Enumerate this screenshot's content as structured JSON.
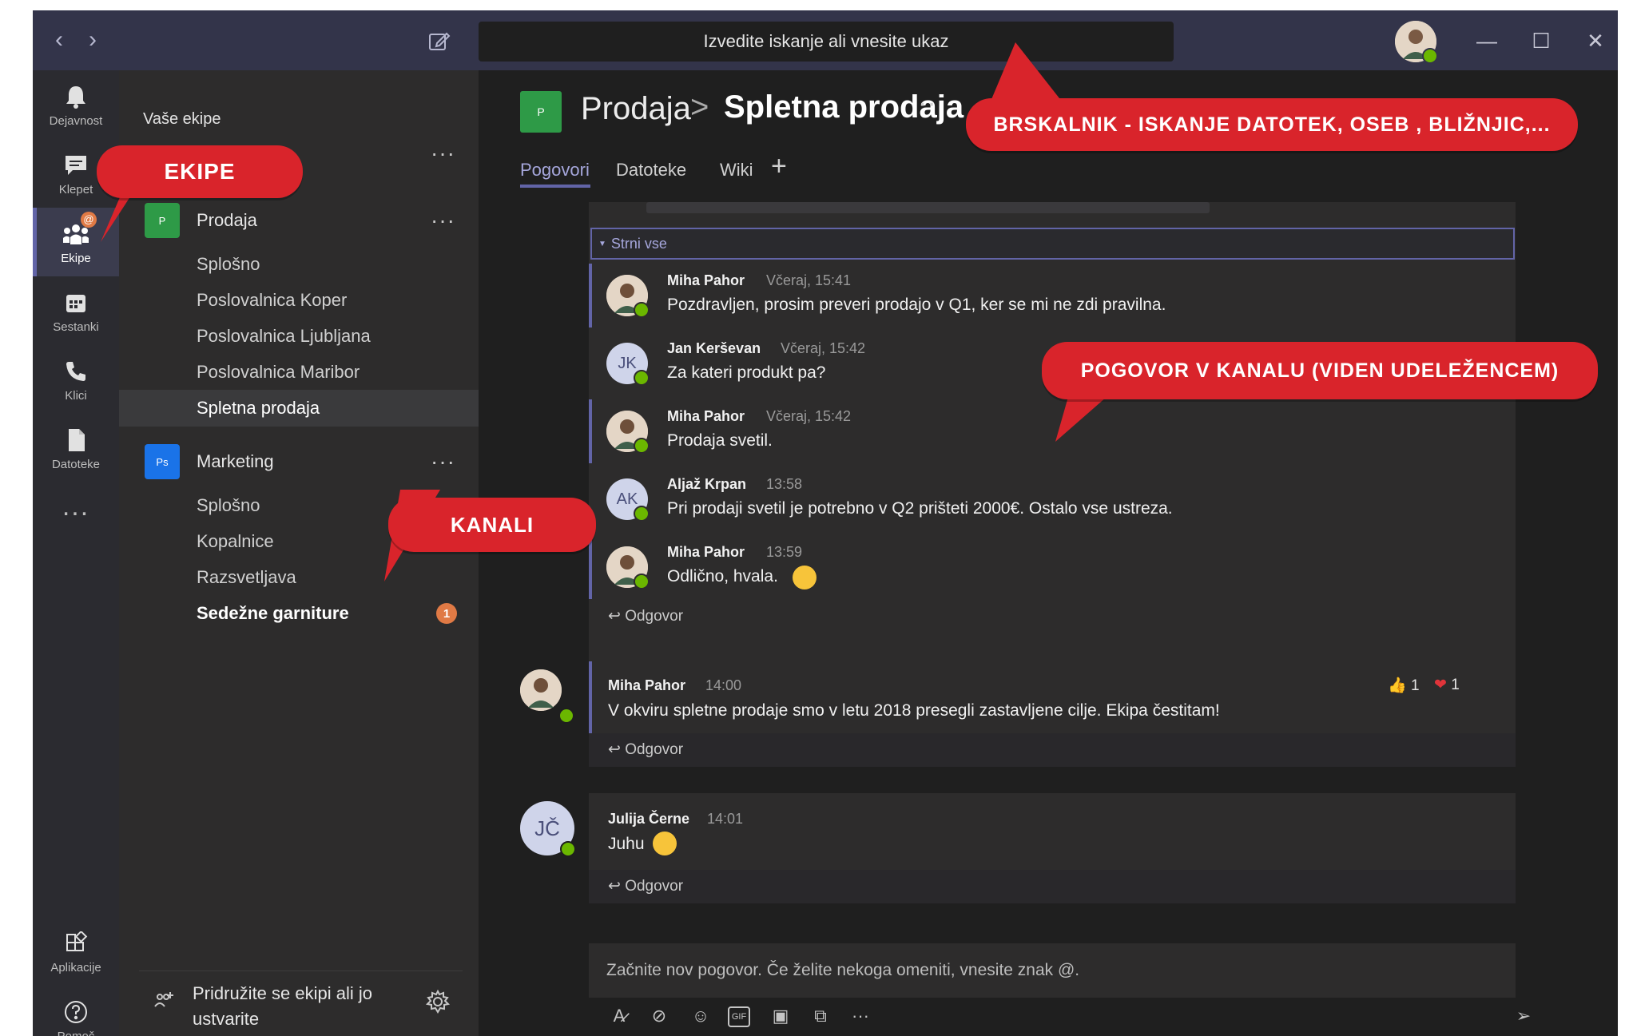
{
  "search": {
    "placeholder": "Izvedite iskanje ali vnesite ukaz"
  },
  "rail": {
    "items": [
      {
        "label": "Dejavnost",
        "icon": "bell-icon"
      },
      {
        "label": "Klepet",
        "icon": "chat-icon"
      },
      {
        "label": "Ekipe",
        "icon": "teams-icon"
      },
      {
        "label": "Sestanki",
        "icon": "calendar-icon"
      },
      {
        "label": "Klici",
        "icon": "phone-icon"
      },
      {
        "label": "Datoteke",
        "icon": "file-icon"
      }
    ],
    "more": "...",
    "apps": "Aplikacije",
    "help": "Pomoč",
    "teams_badge": "@"
  },
  "panel": {
    "title": "Vaše ekipe",
    "teams": [
      {
        "tile": "P",
        "tile_color": "#2e9a47",
        "name": "Prodaja",
        "channels": [
          "Splošno",
          "Poslovalnica Koper",
          "Poslovalnica Ljubljana",
          "Poslovalnica Maribor",
          "Spletna prodaja"
        ]
      },
      {
        "tile": "Ps",
        "tile_color": "#1a73e8",
        "name": "Marketing",
        "channels": [
          "Splošno",
          "Kopalnice",
          "Razsvetljava",
          "Sedežne garniture"
        ]
      }
    ],
    "unread_badge": "1",
    "join": "Pridružite se ekipi ali jo ustvarite"
  },
  "header": {
    "tile": "P",
    "team": "Prodaja",
    "separator": ">",
    "channel": "Spletna prodaja",
    "tabs": [
      "Pogovori",
      "Datoteke",
      "Wiki"
    ],
    "add_tab": "+"
  },
  "thread1": {
    "collapse": "Strni vse",
    "messages": [
      {
        "name": "Miha Pahor",
        "time": "Včeraj, 15:41",
        "text": "Pozdravljen, prosim preveri prodajo v Q1, ker se mi ne zdi pravilna.",
        "avatar": "photo"
      },
      {
        "name": "Jan Kerševan",
        "time": "Včeraj, 15:42",
        "text": "Za kateri produkt pa?",
        "avatar": "JK"
      },
      {
        "name": "Miha Pahor",
        "time": "Včeraj, 15:42",
        "text": "Prodaja svetil.",
        "avatar": "photo"
      },
      {
        "name": "Aljaž Krpan",
        "time": "13:58",
        "text": "Pri prodaji svetil je potrebno v Q2 prišteti 2000€. Ostalo vse ustreza.",
        "avatar": "AK"
      },
      {
        "name": "Miha Pahor",
        "time": "13:59",
        "text": "Odlično, hvala.",
        "avatar": "photo"
      }
    ],
    "reply": "Odgovor"
  },
  "thread2": {
    "name": "Miha Pahor",
    "time": "14:00",
    "text": "V okviru spletne prodaje smo v letu 2018 presegli zastavljene cilje. Ekipa čestitam!",
    "likes": "1",
    "hearts": "1",
    "reply": "Odgovor"
  },
  "thread3": {
    "name": "Julija Černe",
    "time": "14:01",
    "text": "Juhu",
    "avatar": "JČ",
    "reply": "Odgovor"
  },
  "composer": {
    "placeholder": "Začnite nov pogovor. Če želite nekoga omeniti, vnesite znak @."
  },
  "callouts": {
    "teams": "EKIPE",
    "channels": "KANALI",
    "search": "BRSKALNIK - ISKANJE DATOTEK, OSEB , BLIŽNJIC,...",
    "conversation": "POGOVOR V KANALU (VIDEN UDELEŽENCEM)"
  },
  "colors": {
    "accent": "#6264a7",
    "callout": "#d9242b",
    "presence": "#6bb700"
  }
}
